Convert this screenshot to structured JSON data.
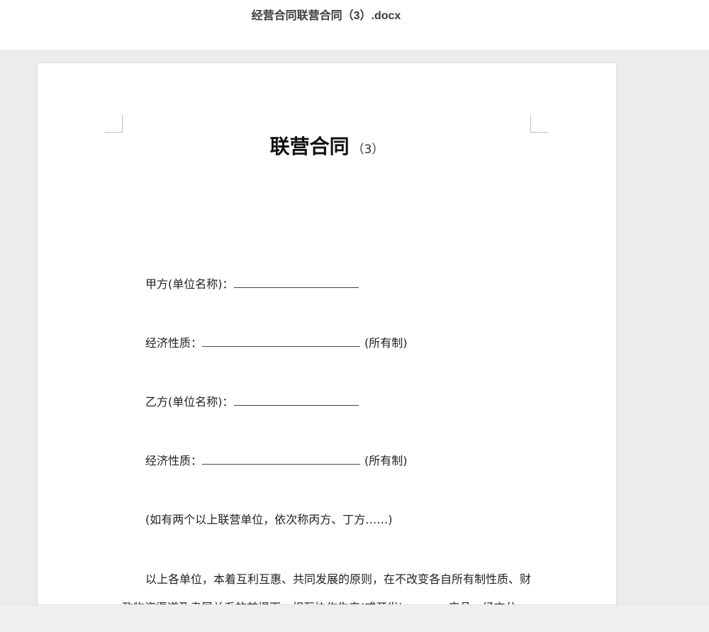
{
  "window": {
    "title": "经营合同联营合同（3）.docx"
  },
  "document": {
    "heading_main": "联营合同",
    "heading_sub": "（3）",
    "lines": [
      {
        "label": "甲方(单位名称)：",
        "suffix": ""
      },
      {
        "label": "经济性质：",
        "suffix": "(所有制)"
      },
      {
        "label": "乙方(单位名称)：",
        "suffix": ""
      },
      {
        "label": "经济性质：",
        "suffix": "(所有制)"
      }
    ],
    "note": "(如有两个以上联营单位，依次称丙方、丁方……)",
    "paragraph1": "以上各单位，本着互利互惠、共同发展的原则，在不改变各自所有制性质、财政物资渠道及隶属关系的前提下，相互协作生产(或开发)________产品，经充分"
  }
}
